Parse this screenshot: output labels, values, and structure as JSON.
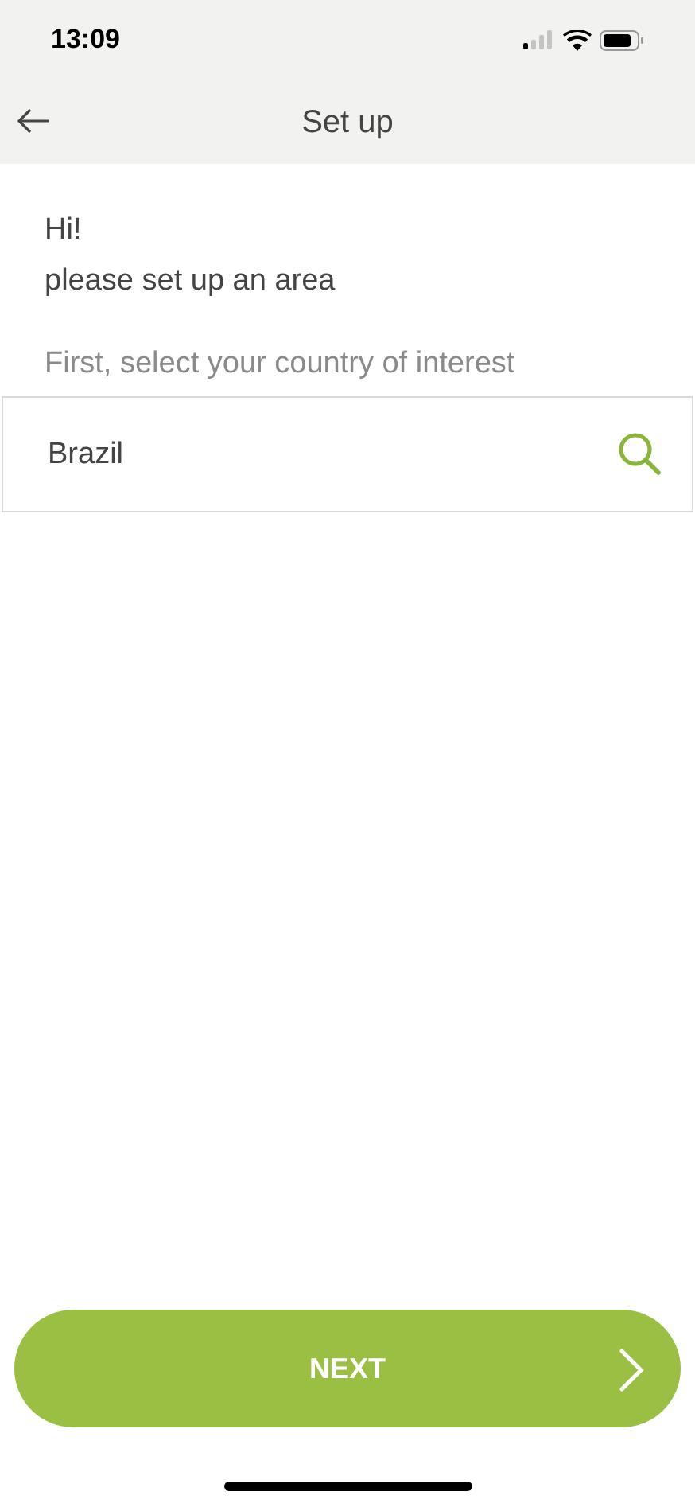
{
  "status_bar": {
    "time": "13:09"
  },
  "header": {
    "title": "Set up"
  },
  "greeting": {
    "line_1": "Hi!",
    "line_2": "please set up an area"
  },
  "country_field": {
    "label": "First, select your country of interest",
    "value": "Brazil"
  },
  "next_button": {
    "label": "NEXT"
  }
}
